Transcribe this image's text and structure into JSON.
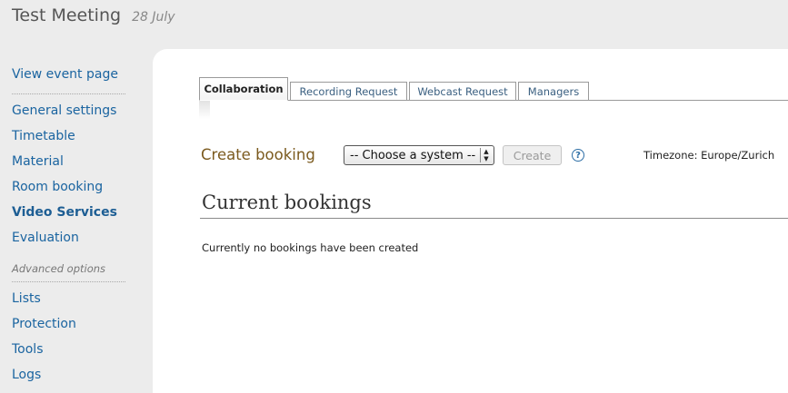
{
  "event": {
    "title": "Test Meeting",
    "date": "28 July"
  },
  "sidebar": {
    "items": [
      {
        "label": "View event page"
      },
      {
        "label": "General settings"
      },
      {
        "label": "Timetable"
      },
      {
        "label": "Material"
      },
      {
        "label": "Room booking"
      },
      {
        "label": "Video Services",
        "active": true
      },
      {
        "label": "Evaluation"
      },
      {
        "label": "Lists"
      },
      {
        "label": "Protection"
      },
      {
        "label": "Tools"
      },
      {
        "label": "Logs"
      }
    ],
    "advanced_heading": "Advanced options"
  },
  "tabs": [
    {
      "label": "Collaboration",
      "active": true
    },
    {
      "label": "Recording Request"
    },
    {
      "label": "Webcast Request"
    },
    {
      "label": "Managers"
    }
  ],
  "booking": {
    "create_label": "Create booking",
    "system_select_value": "-- Choose a system --",
    "create_button": "Create",
    "help_icon": "?",
    "timezone": "Timezone: Europe/Zurich"
  },
  "current_bookings": {
    "heading": "Current bookings",
    "empty_message": "Currently no bookings have been created"
  },
  "colors": {
    "link": "#1a64a0",
    "create_label": "#7b5a1e",
    "page_background": "#ececec"
  }
}
